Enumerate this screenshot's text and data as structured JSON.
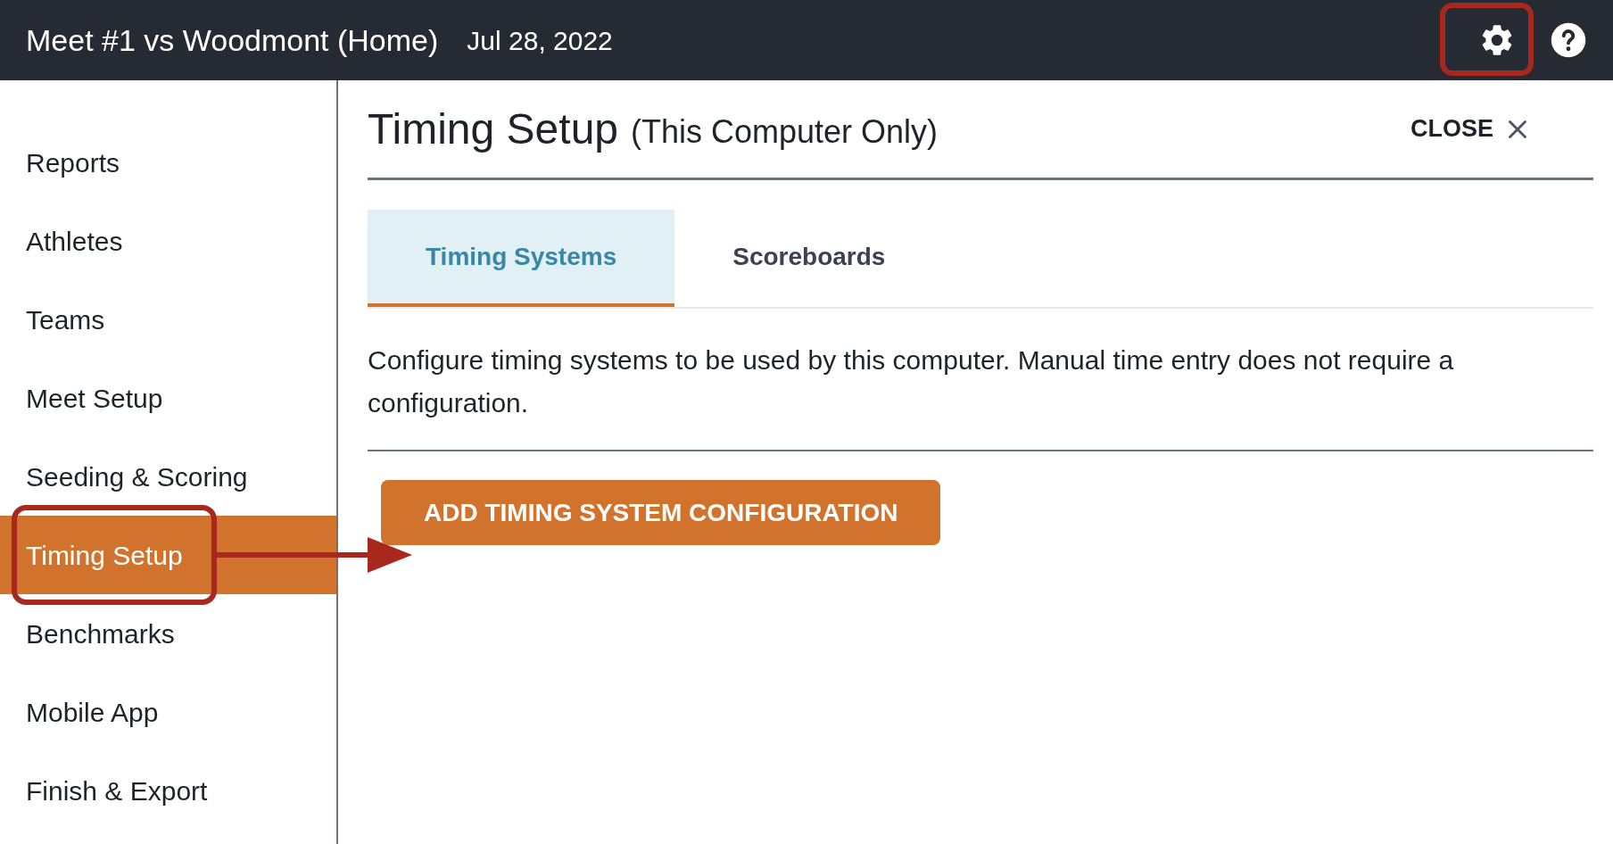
{
  "header": {
    "title": "Meet #1 vs Woodmont (Home)",
    "date": "Jul 28, 2022"
  },
  "sidebar": {
    "items": [
      {
        "label": "Reports",
        "selected": false
      },
      {
        "label": "Athletes",
        "selected": false
      },
      {
        "label": "Teams",
        "selected": false
      },
      {
        "label": "Meet Setup",
        "selected": false
      },
      {
        "label": "Seeding & Scoring",
        "selected": false
      },
      {
        "label": "Timing Setup",
        "selected": true
      },
      {
        "label": "Benchmarks",
        "selected": false
      },
      {
        "label": "Mobile App",
        "selected": false
      },
      {
        "label": "Finish & Export",
        "selected": false
      }
    ]
  },
  "panel": {
    "title": "Timing Setup",
    "subtitle": "(This Computer Only)",
    "close": "CLOSE",
    "tabs": [
      {
        "label": "Timing Systems",
        "selected": true
      },
      {
        "label": "Scoreboards",
        "selected": false
      }
    ],
    "description": "Configure timing systems to be used by this computer. Manual time entry does not require a configuration.",
    "button": "ADD TIMING SYSTEM CONFIGURATION"
  }
}
